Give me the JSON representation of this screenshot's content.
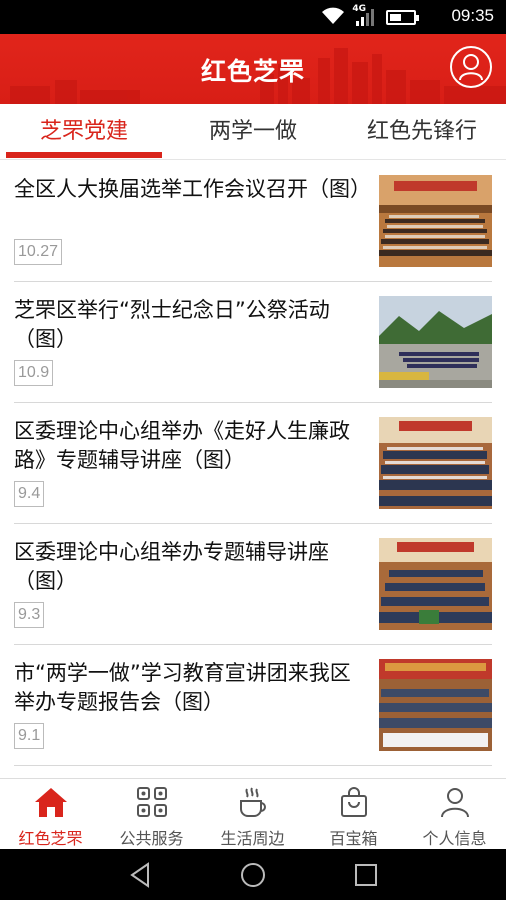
{
  "status_bar": {
    "time": "09:35",
    "network": "4G",
    "wifi_icon": "wifi-icon",
    "signal_icon": "signal-icon",
    "battery_icon": "battery-icon"
  },
  "header": {
    "title": "红色芝罘",
    "user_icon": "user-icon"
  },
  "tabs": [
    {
      "label": "芝罘党建",
      "active": true
    },
    {
      "label": "两学一做",
      "active": false
    },
    {
      "label": "红色先锋行",
      "active": false
    }
  ],
  "news": [
    {
      "title": "全区人大换届选举工作会议召开（图）",
      "date": "10.27"
    },
    {
      "title": "芝罘区举行“烈士纪念日”公祭活动（图）",
      "date": "10.9"
    },
    {
      "title": "区委理论中心组举办《走好人生廉政路》专题辅导讲座（图）",
      "date": "9.4"
    },
    {
      "title": "区委理论中心组举办专题辅导讲座（图）",
      "date": "9.3"
    },
    {
      "title": "市“两学一做”学习教育宣讲团来我区举办专题报告会（图）",
      "date": "9.1"
    }
  ],
  "bottom_nav": [
    {
      "label": "红色芝罘",
      "icon": "home-icon",
      "active": true
    },
    {
      "label": "公共服务",
      "icon": "grid-icon",
      "active": false
    },
    {
      "label": "生活周边",
      "icon": "coffee-cup-icon",
      "active": false
    },
    {
      "label": "百宝箱",
      "icon": "shopping-bag-icon",
      "active": false
    },
    {
      "label": "个人信息",
      "icon": "person-icon",
      "active": false
    }
  ],
  "system_nav": [
    "back-icon",
    "home-circle-icon",
    "recents-icon"
  ],
  "colors": {
    "accent": "#d9251c",
    "header_bg": "#e1251b",
    "text": "#111111",
    "muted": "#999999"
  }
}
